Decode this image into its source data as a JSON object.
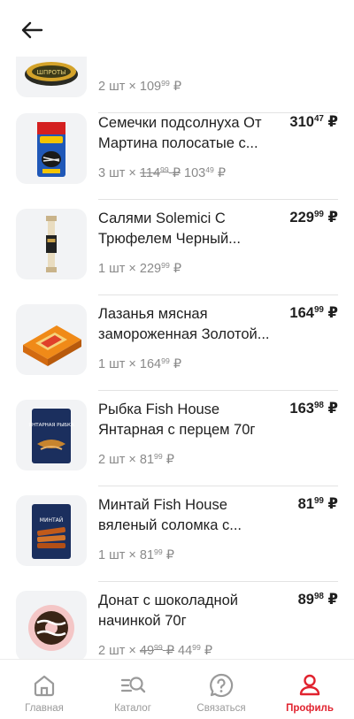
{
  "header": {
    "back_icon": "arrow-left-icon"
  },
  "cart_items": [
    {
      "name": "",
      "qty": "2 шт",
      "sep": "×",
      "old_price_int": "",
      "old_price_frac": "",
      "price_int": "109",
      "price_frac": "99",
      "total_int": "",
      "total_frac": "",
      "thumb_icon": "sprats-can-icon"
    },
    {
      "name": "Семечки подсолнуха От Мартина полосатые с...",
      "qty": "3 шт",
      "sep": "×",
      "old_price_int": "114",
      "old_price_frac": "99",
      "price_int": "103",
      "price_frac": "49",
      "total_int": "310",
      "total_frac": "47",
      "thumb_icon": "seeds-bag-icon"
    },
    {
      "name": "Салями Solemici С Трюфелем Черный...",
      "qty": "1 шт",
      "sep": "×",
      "old_price_int": "",
      "old_price_frac": "",
      "price_int": "229",
      "price_frac": "99",
      "total_int": "229",
      "total_frac": "99",
      "thumb_icon": "salami-stick-icon"
    },
    {
      "name": "Лазанья мясная замороженная Золотой...",
      "qty": "1 шт",
      "sep": "×",
      "old_price_int": "",
      "old_price_frac": "",
      "price_int": "164",
      "price_frac": "99",
      "total_int": "164",
      "total_frac": "99",
      "thumb_icon": "lasagna-box-icon"
    },
    {
      "name": "Рыбка Fish House Янтарная с перцем 70г",
      "qty": "2 шт",
      "sep": "×",
      "old_price_int": "",
      "old_price_frac": "",
      "price_int": "81",
      "price_frac": "99",
      "total_int": "163",
      "total_frac": "98",
      "thumb_icon": "fish-snack-pack-icon",
      "pack_text": "ЯНТАРНАЯ РЫБКА"
    },
    {
      "name": "Минтай Fish House вяленый соломка с...",
      "qty": "1 шт",
      "sep": "×",
      "old_price_int": "",
      "old_price_frac": "",
      "price_int": "81",
      "price_frac": "99",
      "total_int": "81",
      "total_frac": "99",
      "thumb_icon": "pollock-pack-icon",
      "pack_text": "МИНТАЙ"
    },
    {
      "name": "Донат с шоколадной начинкой 70г",
      "qty": "2 шт",
      "sep": "×",
      "old_price_int": "49",
      "old_price_frac": "99",
      "price_int": "44",
      "price_frac": "99",
      "total_int": "89",
      "total_frac": "98",
      "thumb_icon": "donut-icon"
    }
  ],
  "currency": "₽",
  "tabbar": [
    {
      "label": "Главная",
      "icon": "home-icon",
      "active": false
    },
    {
      "label": "Каталог",
      "icon": "catalog-search-icon",
      "active": false
    },
    {
      "label": "Связаться",
      "icon": "question-bubble-icon",
      "active": false
    },
    {
      "label": "Профиль",
      "icon": "profile-icon",
      "active": true
    }
  ],
  "colors": {
    "accent": "#e1232f",
    "text": "#1f1f1f",
    "muted": "#8a8a8a",
    "thumb_bg": "#f2f3f5"
  }
}
